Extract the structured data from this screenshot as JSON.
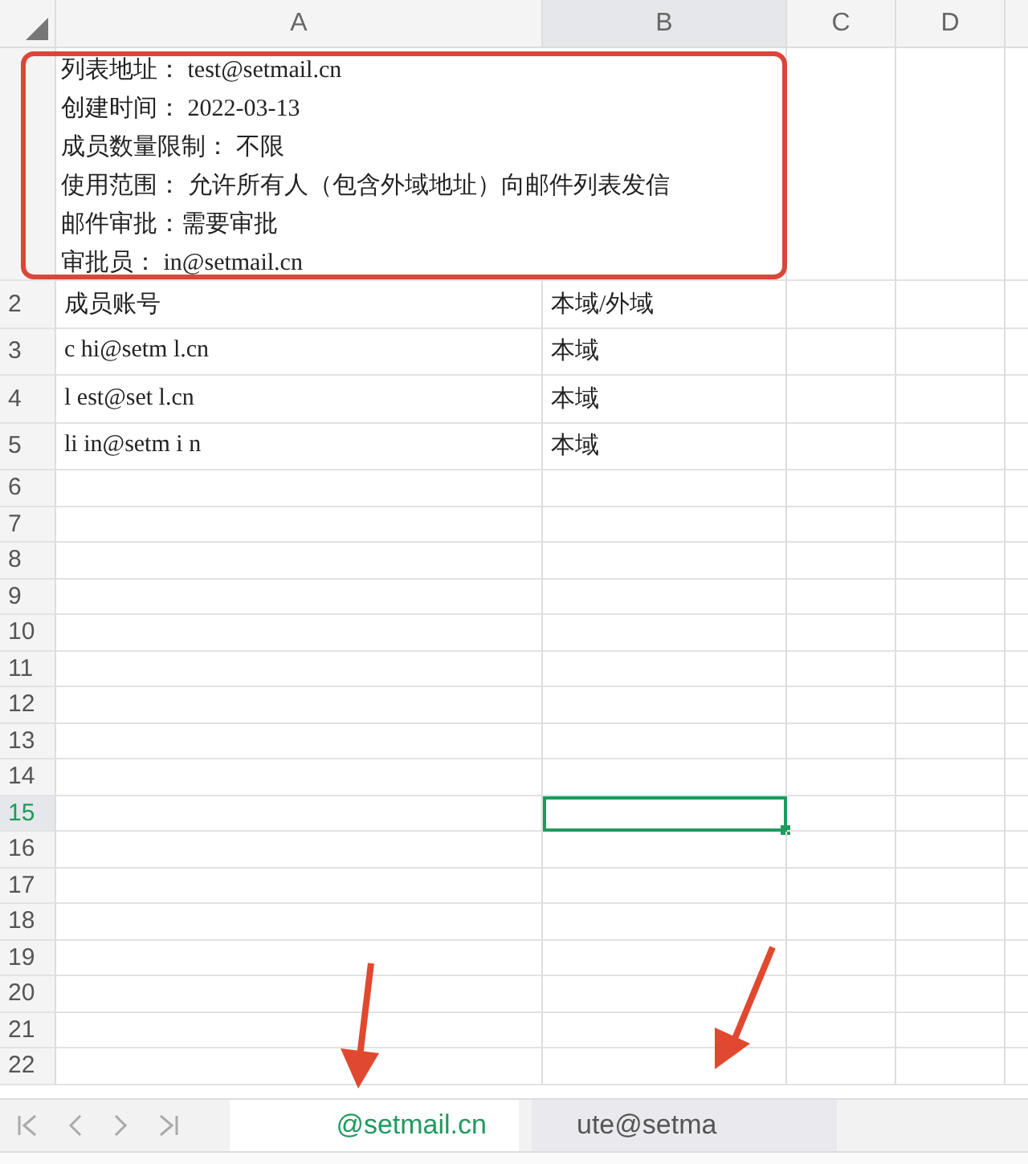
{
  "columns": [
    "A",
    "B",
    "C",
    "D"
  ],
  "info_cell": {
    "lines": [
      "列表地址：  test@setmail.cn",
      "创建时间：  2022-03-13",
      "成员数量限制：  不限",
      "使用范围：  允许所有人（包含外域地址）向邮件列表发信",
      "邮件审批：需要审批",
      "审批员：  in@setmail.cn"
    ]
  },
  "rows": [
    {
      "number": "2",
      "a": "成员账号",
      "b": "本域/外域",
      "selected": false
    },
    {
      "number": "3",
      "a": "c  hi@setm  l.cn",
      "b": "本域",
      "selected": false
    },
    {
      "number": "4",
      "a": "l  est@set  l.cn",
      "b": "本域",
      "selected": false
    },
    {
      "number": "5",
      "a": "li  in@setm  i  n",
      "b": "本域",
      "selected": false
    },
    {
      "number": "6",
      "selected": false
    },
    {
      "number": "7",
      "selected": false
    },
    {
      "number": "8",
      "selected": false
    },
    {
      "number": "9",
      "selected": false
    },
    {
      "number": "10",
      "selected": false
    },
    {
      "number": "11",
      "selected": false
    },
    {
      "number": "12",
      "selected": false
    },
    {
      "number": "13",
      "selected": false
    },
    {
      "number": "14",
      "selected": false
    },
    {
      "number": "15",
      "selected": true
    },
    {
      "number": "16",
      "selected": false
    },
    {
      "number": "17",
      "selected": false
    },
    {
      "number": "18",
      "selected": false
    },
    {
      "number": "19",
      "selected": false
    },
    {
      "number": "20",
      "selected": false
    },
    {
      "number": "21",
      "selected": false
    },
    {
      "number": "22",
      "selected": false
    }
  ],
  "sheet_tabs": [
    {
      "label": "@setmail.cn",
      "selected": true
    },
    {
      "label": "ute@setma",
      "selected": false
    }
  ]
}
